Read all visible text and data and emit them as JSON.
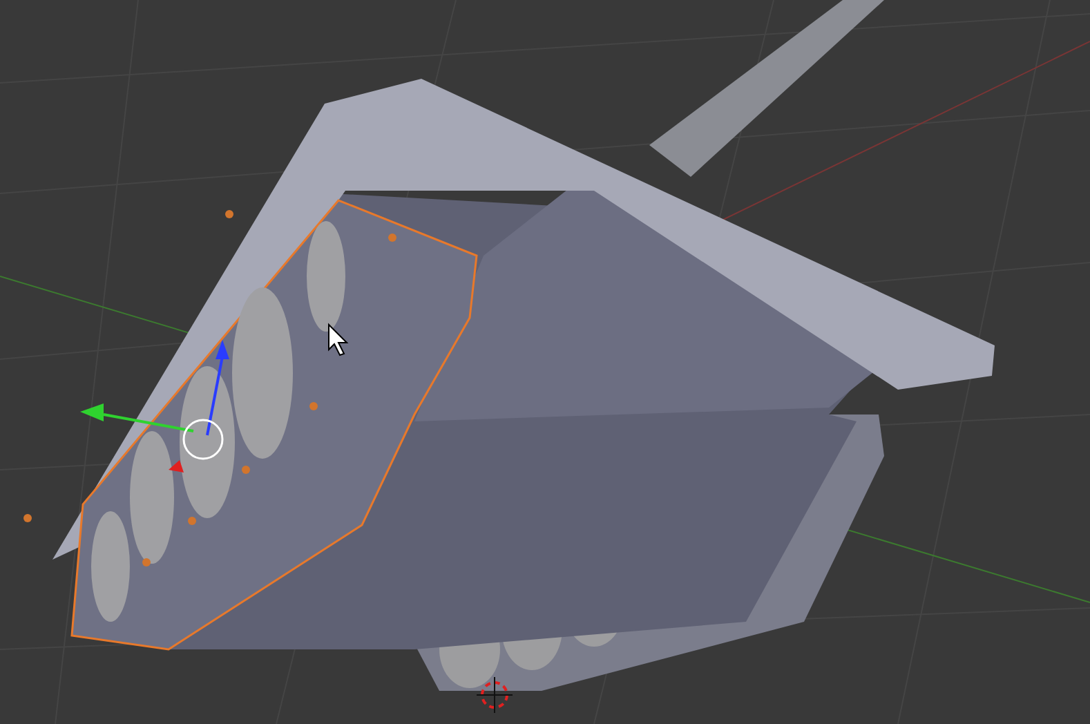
{
  "viewport": {
    "kind": "perspective"
  },
  "track_guard": {
    "selected": true
  }
}
